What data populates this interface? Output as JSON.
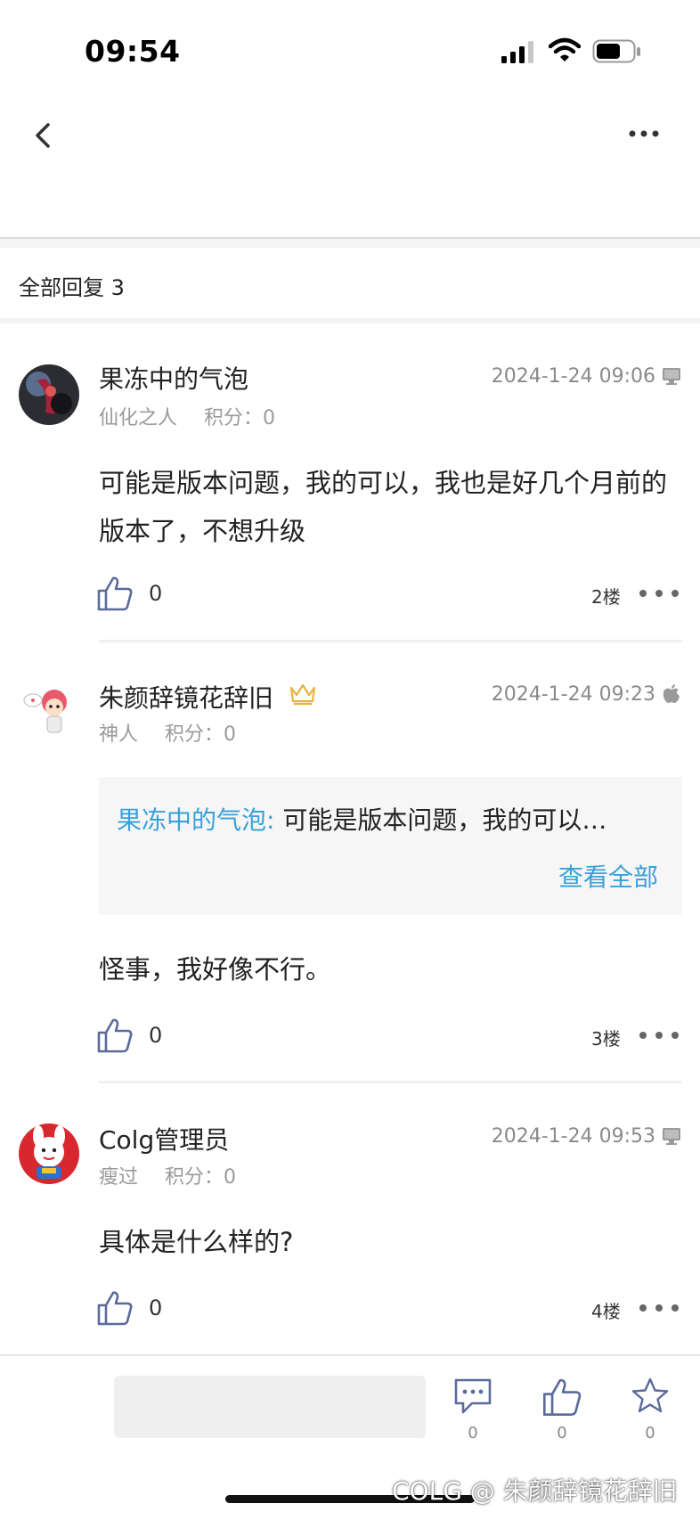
{
  "status_bar": {
    "time": "09:54",
    "icons": [
      "cellular-signal-icon",
      "wifi-icon",
      "battery-icon"
    ]
  },
  "nav": {
    "back_icon": "chevron-left-icon",
    "more_icon": "ellipsis-icon"
  },
  "section": {
    "title": "全部回复 3"
  },
  "comments": [
    {
      "username": "果冻中的气泡",
      "title": "仙化之人",
      "score": "积分：0",
      "time": "2024-1-24 09:06",
      "device_icon": "desktop-icon",
      "body": "可能是版本问题，我的可以，我也是好几个月前的版本了，不想升级",
      "likes": "0",
      "floor": "2楼"
    },
    {
      "username": "朱颜辞镜花辞旧",
      "badge_icon": "crown-icon",
      "title": "神人",
      "score": "积分：0",
      "time": "2024-1-24 09:23",
      "device_icon": "apple-icon",
      "quote": {
        "user": "果冻中的气泡:",
        "text": " 可能是版本问题，我的可以…",
        "view_all": "查看全部"
      },
      "body": "怪事，我好像不行。",
      "likes": "0",
      "floor": "3楼"
    },
    {
      "username": "Colg管理员",
      "title": "瘦过",
      "score": "积分：0",
      "time": "2024-1-24 09:53",
      "device_icon": "desktop-icon",
      "body": "具体是什么样的?",
      "likes": "0",
      "floor": "4楼"
    }
  ],
  "bottom_bar": {
    "comment_count": "0",
    "like_count": "0",
    "favorite_count": "0"
  },
  "watermark": "COLG @ 朱颜辞镜花辞旧",
  "colors": {
    "accent": "#3aa0d8",
    "icon": "#5a6b9a",
    "muted": "#9a9a9a"
  }
}
